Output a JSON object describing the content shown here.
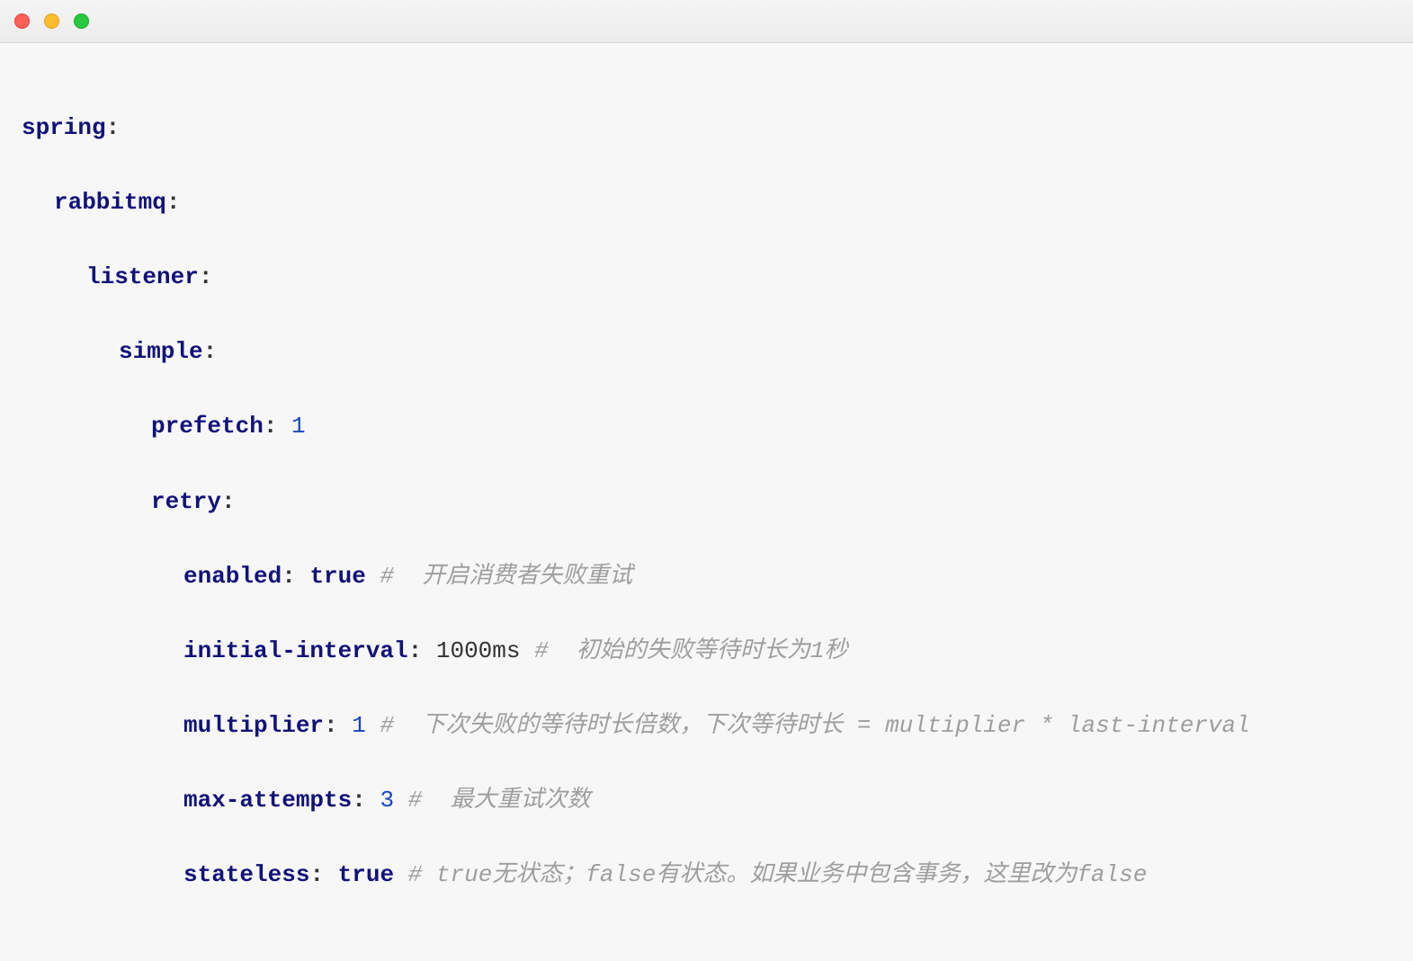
{
  "yaml": {
    "k_spring": "spring",
    "k_rabbitmq": "rabbitmq",
    "k_listener": "listener",
    "k_simple": "simple",
    "k_prefetch": "prefetch",
    "v_prefetch": "1",
    "k_retry": "retry",
    "k_enabled": "enabled",
    "v_enabled": "true",
    "c_enabled": "#  开启消费者失败重试",
    "k_initial_interval": "initial-interval",
    "v_initial_interval": "1000ms",
    "c_initial_interval": "#  初始的失败等待时长为1秒",
    "k_multiplier": "multiplier",
    "v_multiplier": "1",
    "c_multiplier": "#  下次失败的等待时长倍数，下次等待时长 = multiplier * last-interval",
    "k_max_attempts": "max-attempts",
    "v_max_attempts": "3",
    "c_max_attempts": "#  最大重试次数",
    "k_stateless": "stateless",
    "v_stateless": "true",
    "c_stateless": "# true无状态；false有状态。如果业务中包含事务，这里改为false"
  }
}
